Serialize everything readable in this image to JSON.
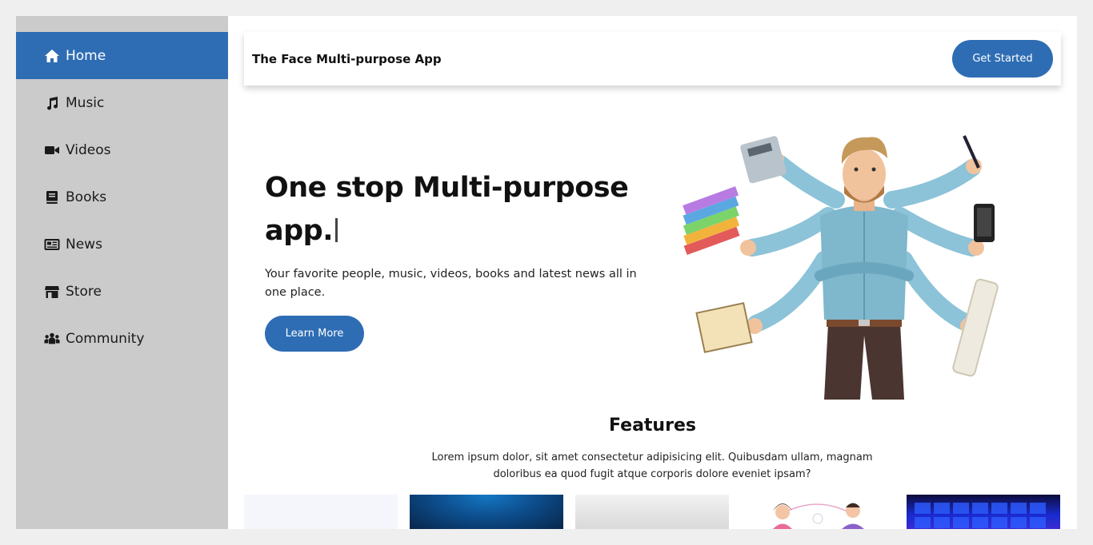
{
  "sidebar": {
    "items": [
      {
        "label": "Home",
        "icon": "home-icon",
        "active": true
      },
      {
        "label": "Music",
        "icon": "music-icon",
        "active": false
      },
      {
        "label": "Videos",
        "icon": "video-icon",
        "active": false
      },
      {
        "label": "Books",
        "icon": "book-icon",
        "active": false
      },
      {
        "label": "News",
        "icon": "newspaper-icon",
        "active": false
      },
      {
        "label": "Store",
        "icon": "store-icon",
        "active": false
      },
      {
        "label": "Community",
        "icon": "users-icon",
        "active": false
      }
    ]
  },
  "header": {
    "brand": "The Face Multi-purpose App",
    "cta_label": "Get Started"
  },
  "hero": {
    "title": "One stop Multi-purpose app.",
    "subtitle": "Your favorite people, music, videos, books and latest news all in one place.",
    "button_label": "Learn More"
  },
  "features": {
    "title": "Features",
    "description": "Lorem ipsum dolor, sit amet consectetur adipisicing elit. Quibusdam ullam, magnam doloribus ea quod fugit atque corporis dolore eveniet ipsam?"
  },
  "colors": {
    "accent": "#2e6db4",
    "sidebar_bg": "#cbcbcb"
  }
}
